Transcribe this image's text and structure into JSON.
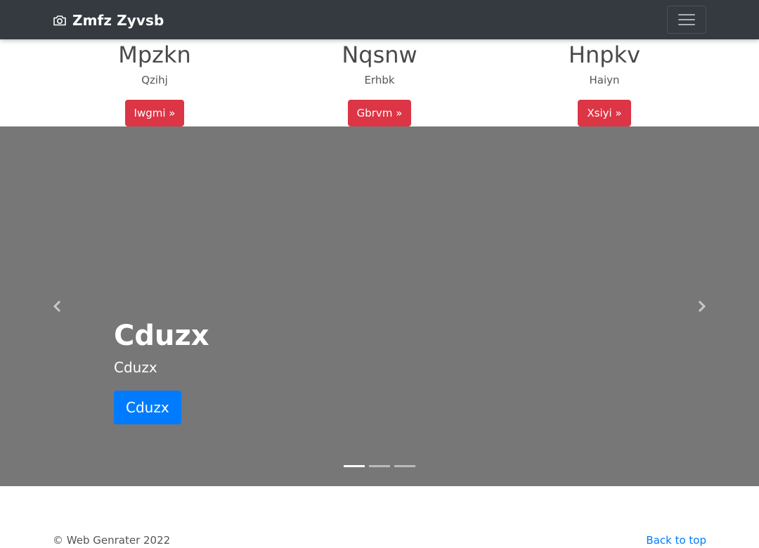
{
  "navbar": {
    "brand": "Zmfz Zyvsb",
    "brand_icon": "camera-icon",
    "toggler_icon": "hamburger-icon",
    "background": "#343a40"
  },
  "features": [
    {
      "title": "Mpzkn",
      "subtitle": "Qzihj",
      "button": "Iwgmi »"
    },
    {
      "title": "Nqsnw",
      "subtitle": "Erhbk",
      "button": "Gbrvm »"
    },
    {
      "title": "Hnpkv",
      "subtitle": "Haiyn",
      "button": "Xsiyi »"
    }
  ],
  "carousel": {
    "heading": "Cduzx",
    "text": "Cduzx",
    "button": "Cduzx",
    "prev_icon": "chevron-left-icon",
    "next_icon": "chevron-right-icon",
    "slide_count": 3,
    "active_slide": 1,
    "background": "#777777"
  },
  "footer": {
    "copyright": "© Web Genrater 2022",
    "back_to_top": "Back to top"
  },
  "colors": {
    "danger": "#dc3545",
    "primary": "#007bff"
  }
}
